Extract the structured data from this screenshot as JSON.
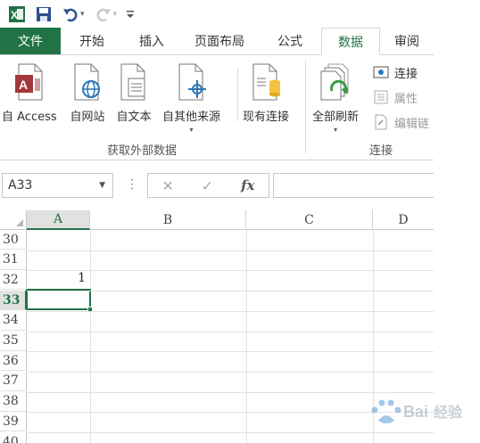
{
  "quick_access": {
    "icons": [
      "excel-logo-icon",
      "save-icon",
      "undo-icon",
      "redo-icon",
      "customize-icon"
    ],
    "logo_letter": "X"
  },
  "tabs": [
    {
      "label": "文件",
      "active": false
    },
    {
      "label": "开始",
      "active": false
    },
    {
      "label": "插入",
      "active": false
    },
    {
      "label": "页面布局",
      "active": false
    },
    {
      "label": "公式",
      "active": false
    },
    {
      "label": "数据",
      "active": true
    },
    {
      "label": "审阅",
      "active": false
    }
  ],
  "ribbon": {
    "get_external": {
      "group_label": "获取外部数据",
      "buttons": [
        {
          "label": "自 Access",
          "icon": "access-icon"
        },
        {
          "label": "自网站",
          "icon": "web-icon"
        },
        {
          "label": "自文本",
          "icon": "text-file-icon"
        },
        {
          "label": "自其他来源",
          "icon": "other-sources-icon"
        }
      ]
    },
    "existing_connections": {
      "label": "现有连接",
      "icon": "existing-connections-icon"
    },
    "connections": {
      "group_label": "连接",
      "refresh_all": {
        "label": "全部刷新",
        "icon": "refresh-all-icon"
      },
      "items": [
        {
          "label": "连接",
          "icon": "connections-icon",
          "enabled": true
        },
        {
          "label": "属性",
          "icon": "properties-icon",
          "enabled": false
        },
        {
          "label": "编辑链",
          "icon": "edit-links-icon",
          "enabled": false
        }
      ]
    }
  },
  "formula_bar": {
    "name_box": "A33",
    "cancel_symbol": "✕",
    "enter_symbol": "✓",
    "fx_label": "fx",
    "formula": ""
  },
  "sheet": {
    "columns": [
      "A",
      "B",
      "C",
      "D"
    ],
    "active_column": "A",
    "rows": [
      "30",
      "31",
      "32",
      "33",
      "34",
      "35",
      "36",
      "37",
      "38",
      "39",
      "40"
    ],
    "active_row": "33",
    "cells": [
      {
        "ref": "A32",
        "value": "1"
      }
    ]
  },
  "colors": {
    "accent": "#217346",
    "ribbon_border": "#d4d4d4"
  }
}
